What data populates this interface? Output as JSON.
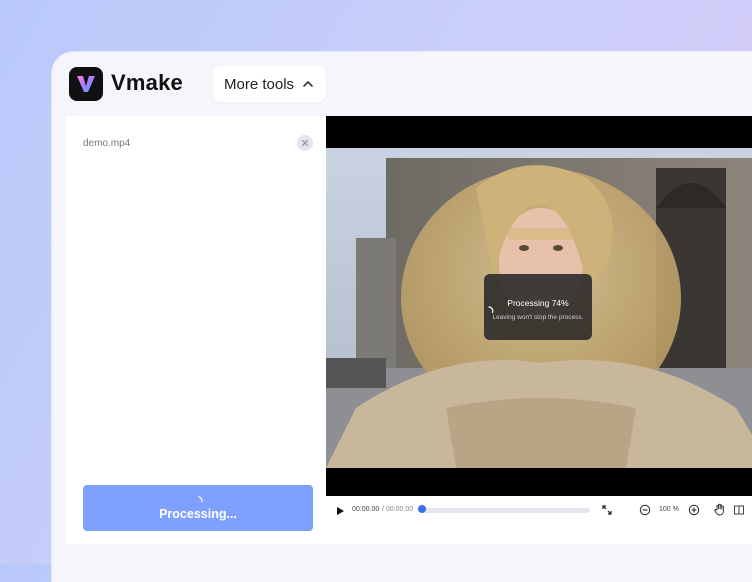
{
  "brand": {
    "name": "Vmake",
    "logo_icon": "v-logo-icon",
    "accent": "#7ea1ff"
  },
  "header": {
    "more_tools_label": "More tools",
    "more_tools_icon": "chevron-up-icon"
  },
  "file": {
    "name": "demo.mp4",
    "close_icon": "close-icon"
  },
  "process_button": {
    "label": "Processing...",
    "spinner_icon": "spinner-icon"
  },
  "overlay": {
    "title": "Processing 74%",
    "subtitle": "Leaving won't stop the process.",
    "progress_percent": 74
  },
  "player": {
    "current_time": "00:00.00",
    "total_time": "/ 00:00.00",
    "progress_fraction": 0,
    "zoom_level": "100 %",
    "icons": [
      "play-icon",
      "fullscreen-icon",
      "zoom-out-icon",
      "zoom-in-icon",
      "hand-icon",
      "compare-icon"
    ]
  }
}
